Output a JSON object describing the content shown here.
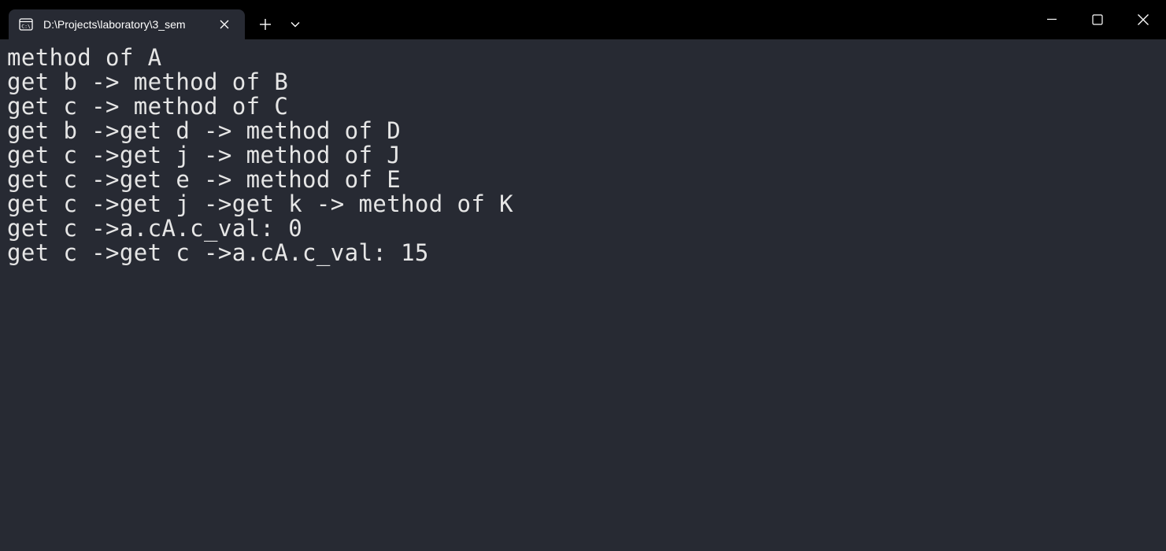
{
  "tab": {
    "title": "D:\\Projects\\laboratory\\3_sem",
    "icon": "terminal-icon"
  },
  "titlebar": {
    "new_tab_icon": "plus-icon",
    "dropdown_icon": "chevron-down-icon",
    "minimize_icon": "minimize-icon",
    "maximize_icon": "maximize-icon",
    "close_icon": "close-icon"
  },
  "colors": {
    "titlebar_bg": "#000000",
    "terminal_bg": "#272a33",
    "text": "#e6e6e6"
  },
  "terminal": {
    "lines": [
      "method of A",
      "get b -> method of B",
      "get c -> method of C",
      "get b ->get d -> method of D",
      "get c ->get j -> method of J",
      "get c ->get e -> method of E",
      "get c ->get j ->get k -> method of K",
      "get c ->a.cA.c_val: 0",
      "get c ->get c ->a.cA.c_val: 15"
    ]
  }
}
